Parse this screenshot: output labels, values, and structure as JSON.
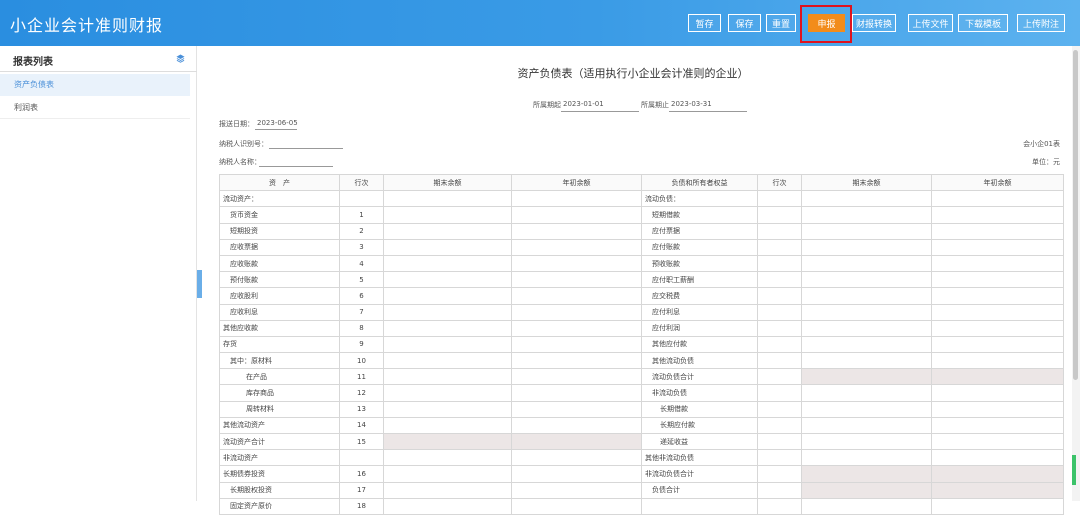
{
  "app": {
    "title": "小企业会计准则财报"
  },
  "toolbar": {
    "buttons": [
      {
        "label": "暂存"
      },
      {
        "label": "保存"
      },
      {
        "label": "重置"
      },
      {
        "label": "申报"
      },
      {
        "label": "财报转换"
      },
      {
        "label": "上传文件"
      },
      {
        "label": "下载模板"
      },
      {
        "label": "上传附注"
      }
    ],
    "highlight_color": "#e0121d",
    "submit_color": "#f28c1b",
    "header_color": "#2a8ee0"
  },
  "sidebar": {
    "title": "报表列表",
    "icon": "layers-icon",
    "items": [
      {
        "label": "资产负债表",
        "active": true
      },
      {
        "label": "利润表",
        "active": false
      }
    ]
  },
  "report": {
    "title": "资产负债表（适用执行小企业会计准则的企业）",
    "period_start_label": "所属期起",
    "period_start": "2023-01-01",
    "period_end_label": "所属期止",
    "period_end": "2023-03-31",
    "report_date_label": "报送日期：",
    "report_date": "2023-06-05",
    "taxpayer_id_label": "纳税人识别号：",
    "taxpayer_id": "",
    "taxpayer_name_label": "纳税人名称：",
    "taxpayer_name": "",
    "form_code": "会小企01表",
    "unit": "单位：元"
  },
  "table": {
    "headers": [
      "资　产",
      "行次",
      "期末余额",
      "年初余额",
      "负债和所有者权益",
      "行次",
      "期末余额",
      "年初余额"
    ],
    "rows": [
      {
        "a": "流动资产：",
        "al": 0,
        "an": "",
        "l": "流动负债：",
        "ll": 0,
        "ln": "",
        "ag": false,
        "lg": false
      },
      {
        "a": "货币资金",
        "al": 1,
        "an": "1",
        "l": "短期借款",
        "ll": 1,
        "ln": "",
        "ag": false,
        "lg": false
      },
      {
        "a": "短期投资",
        "al": 1,
        "an": "2",
        "l": "应付票据",
        "ll": 1,
        "ln": "",
        "ag": false,
        "lg": false
      },
      {
        "a": "应收票据",
        "al": 1,
        "an": "3",
        "l": "应付账款",
        "ll": 1,
        "ln": "",
        "ag": false,
        "lg": false
      },
      {
        "a": "应收账款",
        "al": 1,
        "an": "4",
        "l": "预收账款",
        "ll": 1,
        "ln": "",
        "ag": false,
        "lg": false
      },
      {
        "a": "预付账款",
        "al": 1,
        "an": "5",
        "l": "应付职工薪酬",
        "ll": 1,
        "ln": "",
        "ag": false,
        "lg": false
      },
      {
        "a": "应收股利",
        "al": 1,
        "an": "6",
        "l": "应交税费",
        "ll": 1,
        "ln": "",
        "ag": false,
        "lg": false
      },
      {
        "a": "应收利息",
        "al": 1,
        "an": "7",
        "l": "应付利息",
        "ll": 1,
        "ln": "",
        "ag": false,
        "lg": false
      },
      {
        "a": "其他应收款",
        "al": 0,
        "an": "8",
        "l": "应付利润",
        "ll": 1,
        "ln": "",
        "ag": false,
        "lg": false
      },
      {
        "a": "存货",
        "al": 0,
        "an": "9",
        "l": "其他应付款",
        "ll": 1,
        "ln": "",
        "ag": false,
        "lg": false
      },
      {
        "a": "其中：原材料",
        "al": 1,
        "an": "10",
        "l": "其他流动负债",
        "ll": 1,
        "ln": "",
        "ag": false,
        "lg": false
      },
      {
        "a": "在产品",
        "al": 2,
        "an": "11",
        "l": "流动负债合计",
        "ll": 1,
        "ln": "",
        "ag": false,
        "lg": true
      },
      {
        "a": "库存商品",
        "al": 2,
        "an": "12",
        "l": "非流动负债",
        "ll": 1,
        "ln": "",
        "ag": false,
        "lg": false
      },
      {
        "a": "周转材料",
        "al": 2,
        "an": "13",
        "l": "长期借款",
        "ll": 3,
        "ln": "",
        "ag": false,
        "lg": false
      },
      {
        "a": "其他流动资产",
        "al": 0,
        "an": "14",
        "l": "长期应付款",
        "ll": 3,
        "ln": "",
        "ag": false,
        "lg": false
      },
      {
        "a": "流动资产合计",
        "al": 0,
        "an": "15",
        "l": "递延收益",
        "ll": 3,
        "ln": "",
        "ag": true,
        "lg": false
      },
      {
        "a": "非流动资产",
        "al": 0,
        "an": "",
        "l": "其他非流动负债",
        "ll": 0,
        "ln": "",
        "ag": false,
        "lg": false
      },
      {
        "a": "长期债券投资",
        "al": 0,
        "an": "16",
        "l": "非流动负债合计",
        "ll": 0,
        "ln": "",
        "ag": false,
        "lg": true
      },
      {
        "a": "长期股权投资",
        "al": 1,
        "an": "17",
        "l": "负债合计",
        "ll": 1,
        "ln": "",
        "ag": false,
        "lg": true
      },
      {
        "a": "固定资产原价",
        "al": 1,
        "an": "18",
        "l": "",
        "ll": 0,
        "ln": "",
        "ag": false,
        "lg": false
      }
    ]
  }
}
